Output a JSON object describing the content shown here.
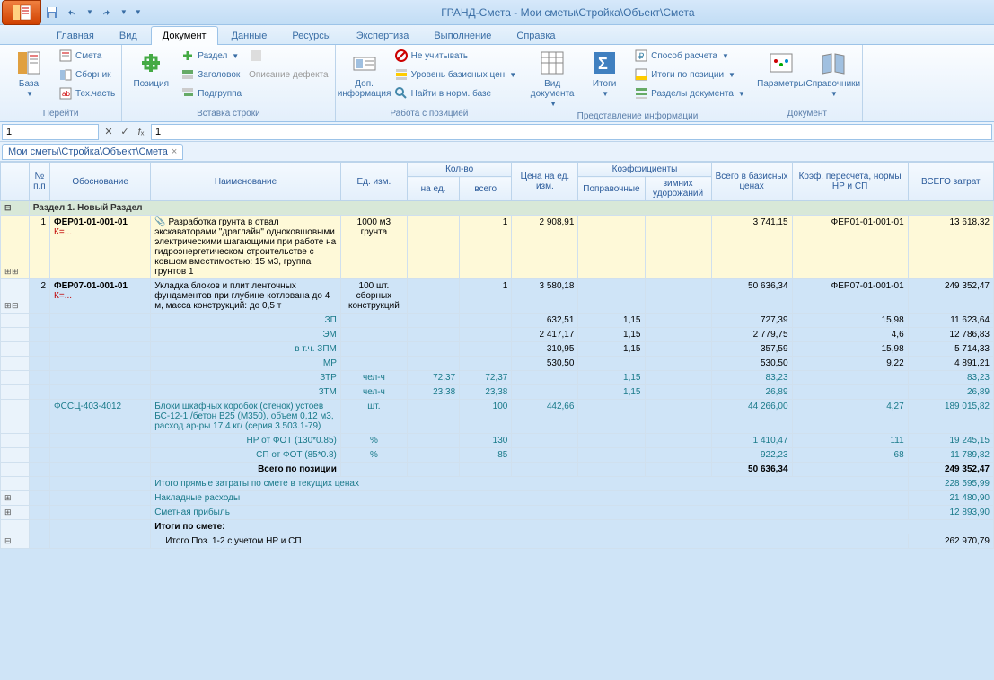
{
  "title": "ГРАНД-Смета - Мои сметы\\Стройка\\Объект\\Смета",
  "tabs": {
    "t0": "Главная",
    "t1": "Вид",
    "t2": "Документ",
    "t3": "Данные",
    "t4": "Ресурсы",
    "t5": "Экспертиза",
    "t6": "Выполнение",
    "t7": "Справка"
  },
  "ribbon": {
    "g0": {
      "title": "Перейти",
      "big": "База",
      "s0": "Смета",
      "s1": "Сборник",
      "s2": "Тех.часть"
    },
    "g1": {
      "title": "Вставка строки",
      "big": "Позиция",
      "s0": "Раздел",
      "s1": "Заголовок",
      "s2": "Подгруппа",
      "s3": "Описание дефекта"
    },
    "g2": {
      "title": "Работа с позицией",
      "big": "Доп. информация",
      "s0": "Не учитывать",
      "s1": "Уровень базисных цен",
      "s2": "Найти в норм. базе"
    },
    "g3": {
      "title": "Представление информации",
      "big0": "Вид документа",
      "big1": "Итоги",
      "s0": "Способ расчета",
      "s1": "Итоги по позиции",
      "s2": "Разделы документа"
    },
    "g4": {
      "title": "Документ",
      "big0": "Параметры",
      "big1": "Справочники"
    }
  },
  "formula": {
    "addr": "1",
    "value": "1"
  },
  "doctab": "Мои сметы\\Стройка\\Объект\\Смета",
  "headers": {
    "c0": "№ п.п",
    "c1": "Обоснование",
    "c2": "Наименование",
    "c3": "Ед. изм.",
    "c4": "Кол-во",
    "c4a": "на ед.",
    "c4b": "всего",
    "c5": "Цена на ед. изм.",
    "c6": "Коэффициенты",
    "c6a": "Поправочные",
    "c6b": "зимних удорожаний",
    "c7": "Всего в базисных ценах",
    "c8": "Коэф. пересчета, нормы НР и СП",
    "c9": "ВСЕГО затрат"
  },
  "section": "Раздел 1. Новый Раздел",
  "rows": {
    "r1": {
      "n": "1",
      "just": "ФЕР01-01-001-01",
      "k": "К=...",
      "name": "Разработка грунта в отвал экскаваторами \"драглайн\" одноковшовыми электрическими шагающими при работе на гидроэнергетическом строительстве с ковшом вместимостью: 15 м3, группа грунтов 1",
      "unit": "1000 м3 грунта",
      "qty": "1",
      "price": "2 908,91",
      "base": "3 741,15",
      "coef": "ФЕР01-01-001-01",
      "total": "13 618,32"
    },
    "r2": {
      "n": "2",
      "just": "ФЕР07-01-001-01",
      "k": "К=...",
      "name": "Укладка блоков и плит ленточных фундаментов при глубине котлована до 4 м, масса конструкций: до 0,5 т",
      "unit": "100 шт. сборных конструкций",
      "qty": "1",
      "price": "3 580,18",
      "base": "50 636,34",
      "coef": "ФЕР07-01-001-01",
      "total": "249 352,47"
    },
    "sub": [
      {
        "name": "ЗП",
        "u": "",
        "a": "",
        "b": "",
        "price": "632,51",
        "cf": "1,15",
        "base": "727,39",
        "rec": "15,98",
        "tot": "11 623,64"
      },
      {
        "name": "ЭМ",
        "u": "",
        "a": "",
        "b": "",
        "price": "2 417,17",
        "cf": "1,15",
        "base": "2 779,75",
        "rec": "4,6",
        "tot": "12 786,83"
      },
      {
        "name": "в т.ч. ЗПМ",
        "u": "",
        "a": "",
        "b": "",
        "price": "310,95",
        "cf": "1,15",
        "base": "357,59",
        "rec": "15,98",
        "tot": "5 714,33"
      },
      {
        "name": "МР",
        "u": "",
        "a": "",
        "b": "",
        "price": "530,50",
        "cf": "",
        "base": "530,50",
        "rec": "9,22",
        "tot": "4 891,21"
      },
      {
        "name": "ЗТР",
        "u": "чел-ч",
        "a": "72,37",
        "b": "72,37",
        "price": "",
        "cf": "1,15",
        "base": "83,23",
        "rec": "",
        "tot": "83,23"
      },
      {
        "name": "ЗТМ",
        "u": "чел-ч",
        "a": "23,38",
        "b": "23,38",
        "price": "",
        "cf": "1,15",
        "base": "26,89",
        "rec": "",
        "tot": "26,89"
      }
    ],
    "mat": {
      "just": "ФССЦ-403-4012",
      "name": "Блоки шкафных коробок (стенок) устоев БС-12-1 /бетон В25 (М350), объем 0,12 м3, расход ар-ры 17,4 кг/ (серия 3.503.1-79)",
      "u": "шт.",
      "b": "100",
      "price": "442,66",
      "base": "44 266,00",
      "rec": "4,27",
      "tot": "189 015,82"
    },
    "nr": {
      "name": "НР от ФОТ (130*0.85)",
      "u": "%",
      "b": "130",
      "base": "1 410,47",
      "rec": "111",
      "tot": "19 245,15"
    },
    "sp": {
      "name": "СП от ФОТ (85*0.8)",
      "u": "%",
      "b": "85",
      "base": "922,23",
      "rec": "68",
      "tot": "11 789,82"
    },
    "total_pos": {
      "name": "Всего по позиции",
      "base": "50 636,34",
      "tot": "249 352,47"
    },
    "footer": [
      {
        "name": "Итого прямые затраты по смете в текущих ценах",
        "tot": "228 595,99"
      },
      {
        "name": "Накладные расходы",
        "tot": "21 480,90"
      },
      {
        "name": "Сметная прибыль",
        "tot": "12 893,90"
      }
    ],
    "itogi": "Итоги по смете:",
    "final": {
      "name": "Итого Поз. 1-2 с учетом НР и СП",
      "tot": "262 970,79"
    }
  }
}
